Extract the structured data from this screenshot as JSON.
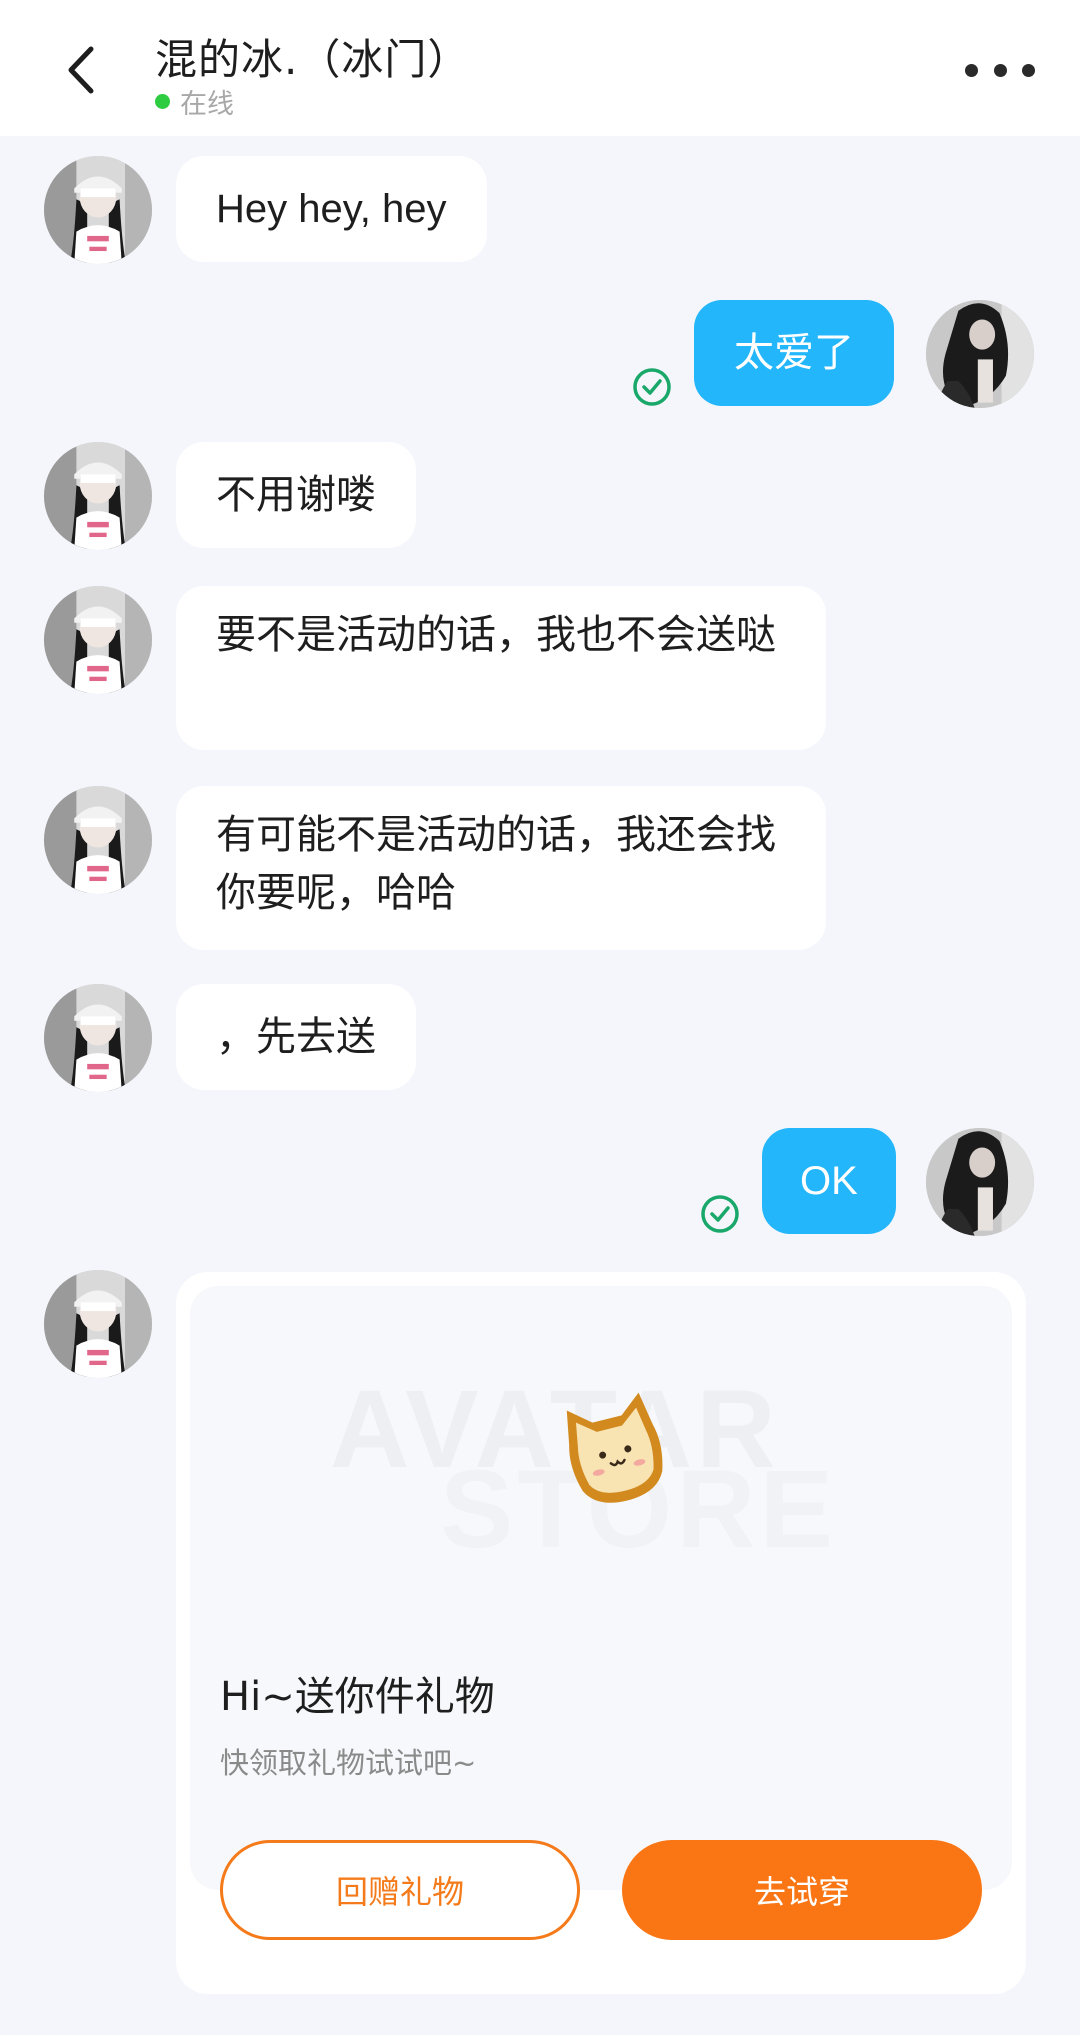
{
  "header": {
    "title": "混的冰.（冰门）",
    "status_text": "在线",
    "status_color": "#2ecc40"
  },
  "messages": [
    {
      "side": "received",
      "text": "Hey hey, hey"
    },
    {
      "side": "sent",
      "text": "太爱了",
      "status": "read"
    },
    {
      "side": "received",
      "text": "不用谢喽"
    },
    {
      "side": "received",
      "text": "要不是活动的话，我也不会送哒"
    },
    {
      "side": "received",
      "text": "有可能不是活动的话，我还会找你要呢，哈哈"
    },
    {
      "side": "received",
      "text": "，先去送"
    },
    {
      "side": "sent",
      "text": "OK",
      "status": "read"
    }
  ],
  "gift": {
    "banner_text_1": "AVATAR",
    "banner_text_2": "STORE",
    "title": "Hi~送你件礼物",
    "subtitle": "快领取礼物试试吧~",
    "return_label": "回赠礼物",
    "try_label": "去试穿"
  },
  "colors": {
    "sent_bubble": "#23b6fa",
    "received_bubble": "#ffffff",
    "accent_orange": "#fa7514",
    "read_check": "#1aa86a",
    "background": "#f4f6fb"
  }
}
